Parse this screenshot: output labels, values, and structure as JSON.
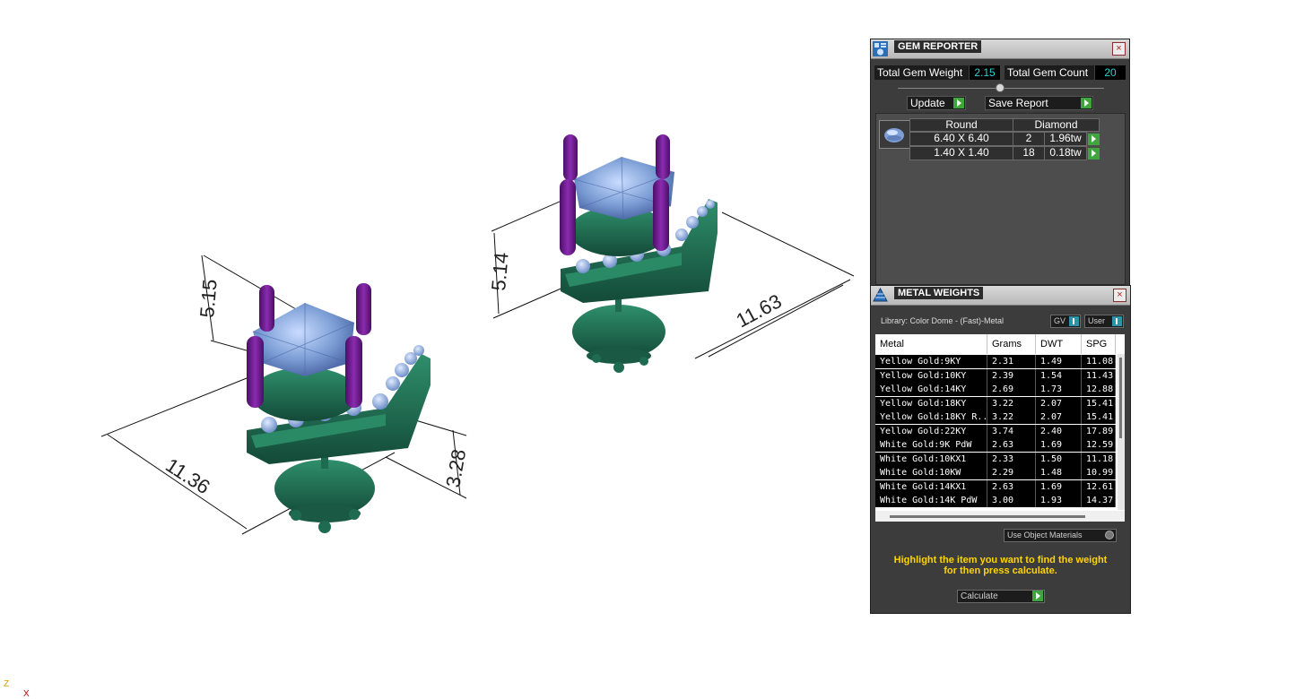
{
  "viewport": {
    "dimensions": [
      "5.15",
      "11.36",
      "3.28",
      "5.14",
      "11.63"
    ],
    "axis": {
      "z": "Z",
      "x": "X"
    }
  },
  "gem_reporter": {
    "title": "GEM REPORTER",
    "close": "×",
    "total_weight_label": "Total Gem Weight",
    "total_weight_value": "2.15",
    "total_count_label": "Total Gem Count",
    "total_count_value": "20",
    "update_label": "Update",
    "save_report_label": "Save Report",
    "shape": "Round",
    "material": "Diamond",
    "rows": [
      {
        "size": "6.40 X 6.40",
        "count": "2",
        "weight": "1.96tw"
      },
      {
        "size": "1.40 X 1.40",
        "count": "18",
        "weight": "0.18tw"
      }
    ]
  },
  "metal_weights": {
    "title": "METAL WEIGHTS",
    "close": "×",
    "library": "Library: Color Dome - (Fast)-Metal",
    "gv_label": "GV",
    "user_label": "User",
    "columns": [
      "Metal",
      "Grams",
      "DWT",
      "SPG"
    ],
    "rows": [
      {
        "metal": "Yellow Gold:9KY",
        "grams": "2.31",
        "dwt": "1.49",
        "spg": "11.08"
      },
      {
        "metal": "Yellow Gold:10KY",
        "grams": "2.39",
        "dwt": "1.54",
        "spg": "11.43"
      },
      {
        "metal": "Yellow Gold:14KY",
        "grams": "2.69",
        "dwt": "1.73",
        "spg": "12.88"
      },
      {
        "metal": "Yellow Gold:18KY",
        "grams": "3.22",
        "dwt": "2.07",
        "spg": "15.41"
      },
      {
        "metal": "Yellow Gold:18KY R...",
        "grams": "3.22",
        "dwt": "2.07",
        "spg": "15.41"
      },
      {
        "metal": "Yellow Gold:22KY",
        "grams": "3.74",
        "dwt": "2.40",
        "spg": "17.89"
      },
      {
        "metal": "White Gold:9K PdW",
        "grams": "2.63",
        "dwt": "1.69",
        "spg": "12.59"
      },
      {
        "metal": "White Gold:10KX1",
        "grams": "2.33",
        "dwt": "1.50",
        "spg": "11.18"
      },
      {
        "metal": "White Gold:10KW",
        "grams": "2.29",
        "dwt": "1.48",
        "spg": "10.99"
      },
      {
        "metal": "White Gold:14KX1",
        "grams": "2.63",
        "dwt": "1.69",
        "spg": "12.61"
      },
      {
        "metal": "White Gold:14K PdW",
        "grams": "3.00",
        "dwt": "1.93",
        "spg": "14.37"
      }
    ],
    "use_object_materials": "Use Object Materials",
    "instruction_line1": "Highlight the item you want to find the weight",
    "instruction_line2": "for then press calculate.",
    "calculate_label": "Calculate"
  },
  "colors": {
    "metal_green": "#1f6b52",
    "gem_blue": "#7d9fd6",
    "prong_purple": "#6a1a8a",
    "panel_bg": "#3c3c3c",
    "value_cyan": "#30d0d0",
    "instruction_yellow": "#ffd400"
  }
}
